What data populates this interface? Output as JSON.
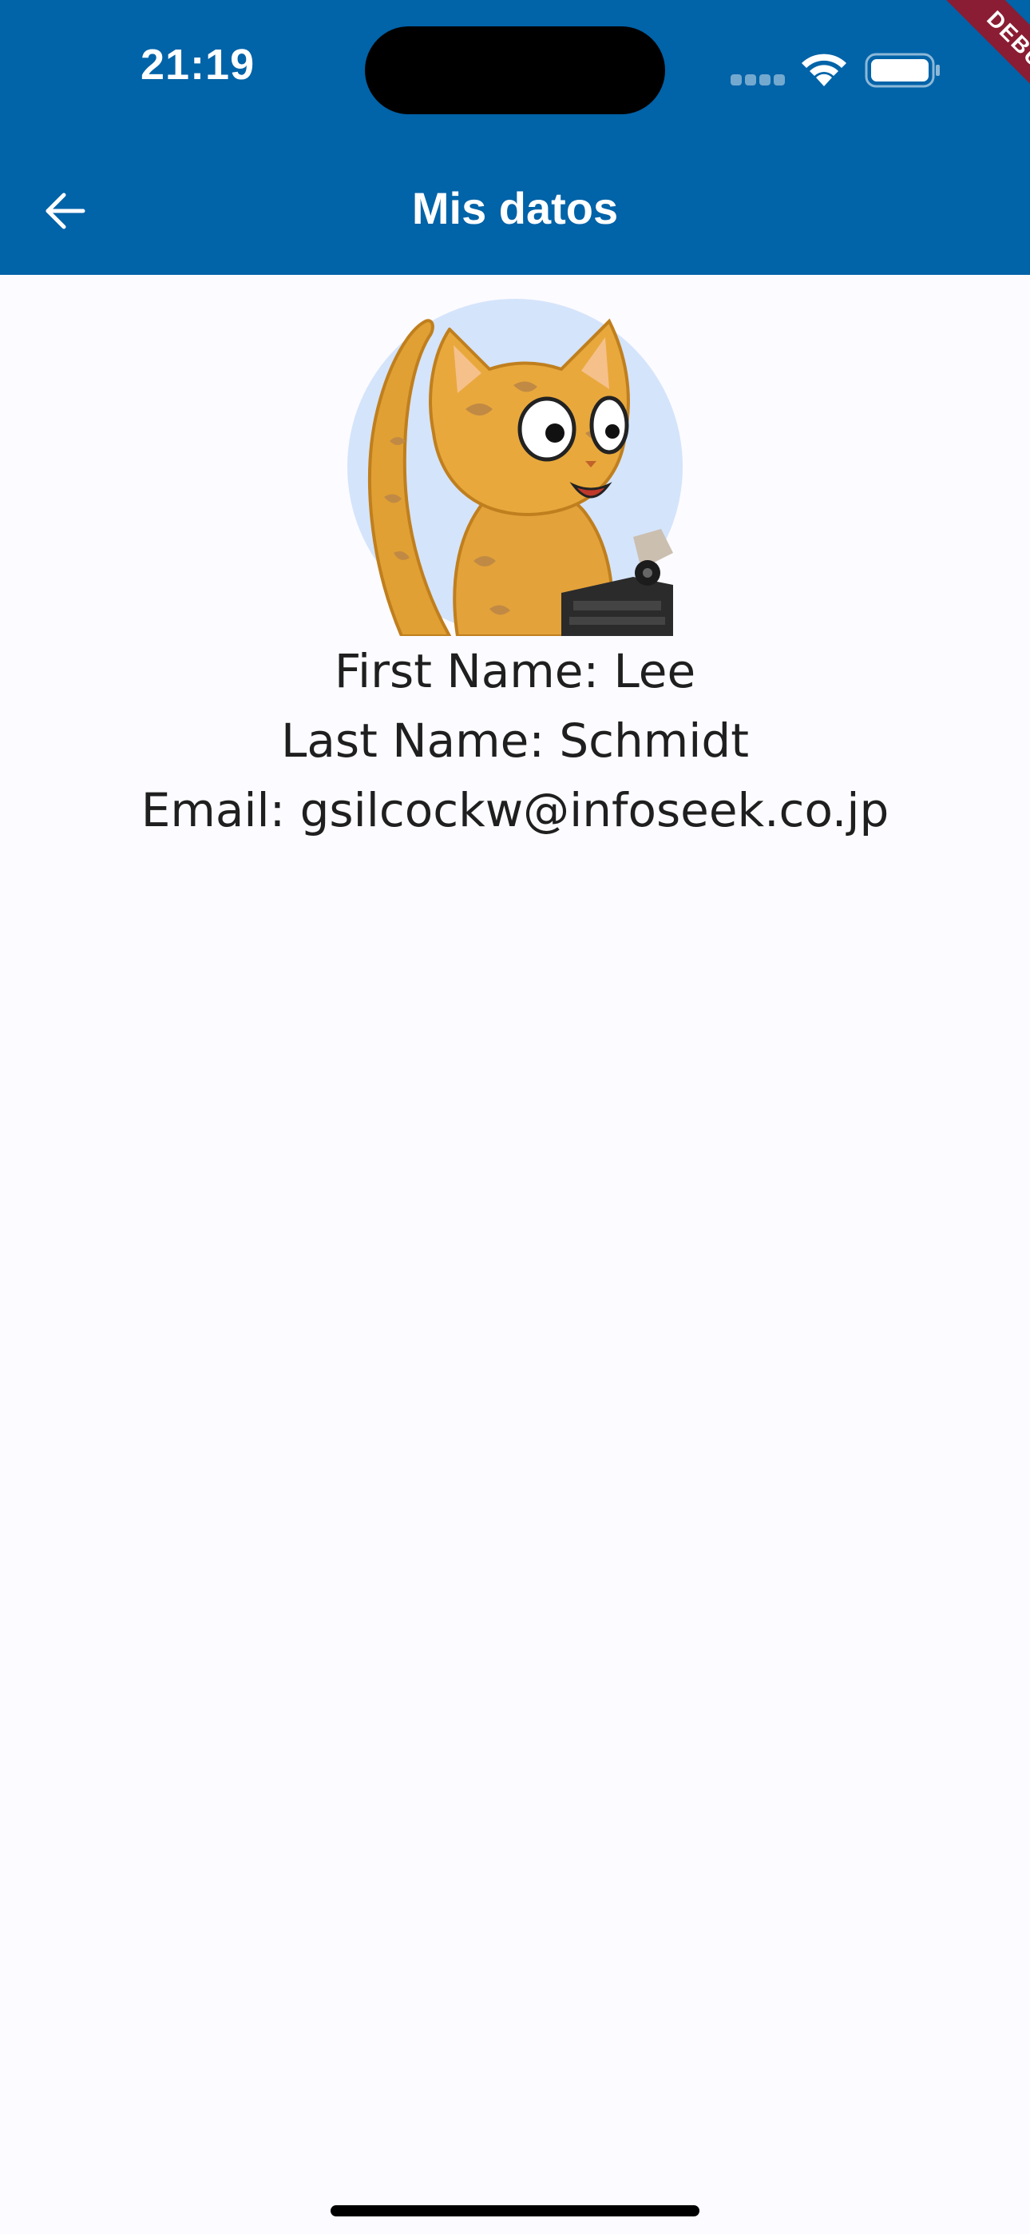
{
  "status_bar": {
    "time": "21:19"
  },
  "debug_banner": {
    "label": "DEBUG"
  },
  "app_bar": {
    "title": "Mis datos",
    "back_icon": "arrow-back-icon"
  },
  "profile": {
    "first_name_line": "First Name: Lee",
    "last_name_line": "Last Name: Schmidt",
    "email_line": "Email: gsilcockw@infoseek.co.jp"
  },
  "colors": {
    "app_bar": "#0163a8",
    "background": "#fcfbff",
    "debug_ribbon": "#8a1d33"
  }
}
